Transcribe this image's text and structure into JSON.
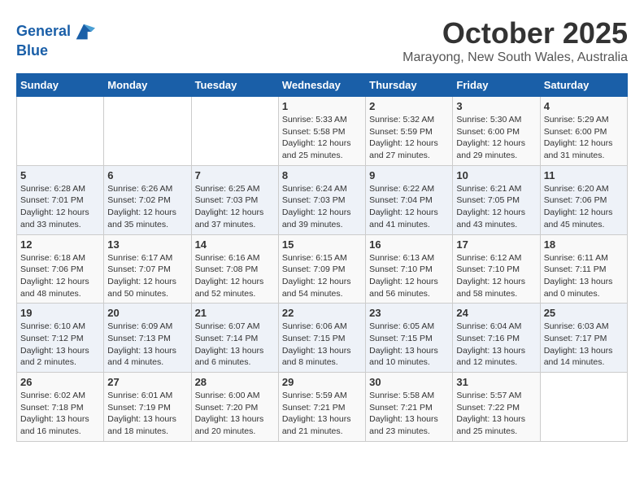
{
  "header": {
    "logo_line1": "General",
    "logo_line2": "Blue",
    "title": "October 2025",
    "subtitle": "Marayong, New South Wales, Australia"
  },
  "days_of_week": [
    "Sunday",
    "Monday",
    "Tuesday",
    "Wednesday",
    "Thursday",
    "Friday",
    "Saturday"
  ],
  "weeks": [
    [
      {
        "day": "",
        "info": ""
      },
      {
        "day": "",
        "info": ""
      },
      {
        "day": "",
        "info": ""
      },
      {
        "day": "1",
        "info": "Sunrise: 5:33 AM\nSunset: 5:58 PM\nDaylight: 12 hours\nand 25 minutes."
      },
      {
        "day": "2",
        "info": "Sunrise: 5:32 AM\nSunset: 5:59 PM\nDaylight: 12 hours\nand 27 minutes."
      },
      {
        "day": "3",
        "info": "Sunrise: 5:30 AM\nSunset: 6:00 PM\nDaylight: 12 hours\nand 29 minutes."
      },
      {
        "day": "4",
        "info": "Sunrise: 5:29 AM\nSunset: 6:00 PM\nDaylight: 12 hours\nand 31 minutes."
      }
    ],
    [
      {
        "day": "5",
        "info": "Sunrise: 6:28 AM\nSunset: 7:01 PM\nDaylight: 12 hours\nand 33 minutes."
      },
      {
        "day": "6",
        "info": "Sunrise: 6:26 AM\nSunset: 7:02 PM\nDaylight: 12 hours\nand 35 minutes."
      },
      {
        "day": "7",
        "info": "Sunrise: 6:25 AM\nSunset: 7:03 PM\nDaylight: 12 hours\nand 37 minutes."
      },
      {
        "day": "8",
        "info": "Sunrise: 6:24 AM\nSunset: 7:03 PM\nDaylight: 12 hours\nand 39 minutes."
      },
      {
        "day": "9",
        "info": "Sunrise: 6:22 AM\nSunset: 7:04 PM\nDaylight: 12 hours\nand 41 minutes."
      },
      {
        "day": "10",
        "info": "Sunrise: 6:21 AM\nSunset: 7:05 PM\nDaylight: 12 hours\nand 43 minutes."
      },
      {
        "day": "11",
        "info": "Sunrise: 6:20 AM\nSunset: 7:06 PM\nDaylight: 12 hours\nand 45 minutes."
      }
    ],
    [
      {
        "day": "12",
        "info": "Sunrise: 6:18 AM\nSunset: 7:06 PM\nDaylight: 12 hours\nand 48 minutes."
      },
      {
        "day": "13",
        "info": "Sunrise: 6:17 AM\nSunset: 7:07 PM\nDaylight: 12 hours\nand 50 minutes."
      },
      {
        "day": "14",
        "info": "Sunrise: 6:16 AM\nSunset: 7:08 PM\nDaylight: 12 hours\nand 52 minutes."
      },
      {
        "day": "15",
        "info": "Sunrise: 6:15 AM\nSunset: 7:09 PM\nDaylight: 12 hours\nand 54 minutes."
      },
      {
        "day": "16",
        "info": "Sunrise: 6:13 AM\nSunset: 7:10 PM\nDaylight: 12 hours\nand 56 minutes."
      },
      {
        "day": "17",
        "info": "Sunrise: 6:12 AM\nSunset: 7:10 PM\nDaylight: 12 hours\nand 58 minutes."
      },
      {
        "day": "18",
        "info": "Sunrise: 6:11 AM\nSunset: 7:11 PM\nDaylight: 13 hours\nand 0 minutes."
      }
    ],
    [
      {
        "day": "19",
        "info": "Sunrise: 6:10 AM\nSunset: 7:12 PM\nDaylight: 13 hours\nand 2 minutes."
      },
      {
        "day": "20",
        "info": "Sunrise: 6:09 AM\nSunset: 7:13 PM\nDaylight: 13 hours\nand 4 minutes."
      },
      {
        "day": "21",
        "info": "Sunrise: 6:07 AM\nSunset: 7:14 PM\nDaylight: 13 hours\nand 6 minutes."
      },
      {
        "day": "22",
        "info": "Sunrise: 6:06 AM\nSunset: 7:15 PM\nDaylight: 13 hours\nand 8 minutes."
      },
      {
        "day": "23",
        "info": "Sunrise: 6:05 AM\nSunset: 7:15 PM\nDaylight: 13 hours\nand 10 minutes."
      },
      {
        "day": "24",
        "info": "Sunrise: 6:04 AM\nSunset: 7:16 PM\nDaylight: 13 hours\nand 12 minutes."
      },
      {
        "day": "25",
        "info": "Sunrise: 6:03 AM\nSunset: 7:17 PM\nDaylight: 13 hours\nand 14 minutes."
      }
    ],
    [
      {
        "day": "26",
        "info": "Sunrise: 6:02 AM\nSunset: 7:18 PM\nDaylight: 13 hours\nand 16 minutes."
      },
      {
        "day": "27",
        "info": "Sunrise: 6:01 AM\nSunset: 7:19 PM\nDaylight: 13 hours\nand 18 minutes."
      },
      {
        "day": "28",
        "info": "Sunrise: 6:00 AM\nSunset: 7:20 PM\nDaylight: 13 hours\nand 20 minutes."
      },
      {
        "day": "29",
        "info": "Sunrise: 5:59 AM\nSunset: 7:21 PM\nDaylight: 13 hours\nand 21 minutes."
      },
      {
        "day": "30",
        "info": "Sunrise: 5:58 AM\nSunset: 7:21 PM\nDaylight: 13 hours\nand 23 minutes."
      },
      {
        "day": "31",
        "info": "Sunrise: 5:57 AM\nSunset: 7:22 PM\nDaylight: 13 hours\nand 25 minutes."
      },
      {
        "day": "",
        "info": ""
      }
    ]
  ]
}
